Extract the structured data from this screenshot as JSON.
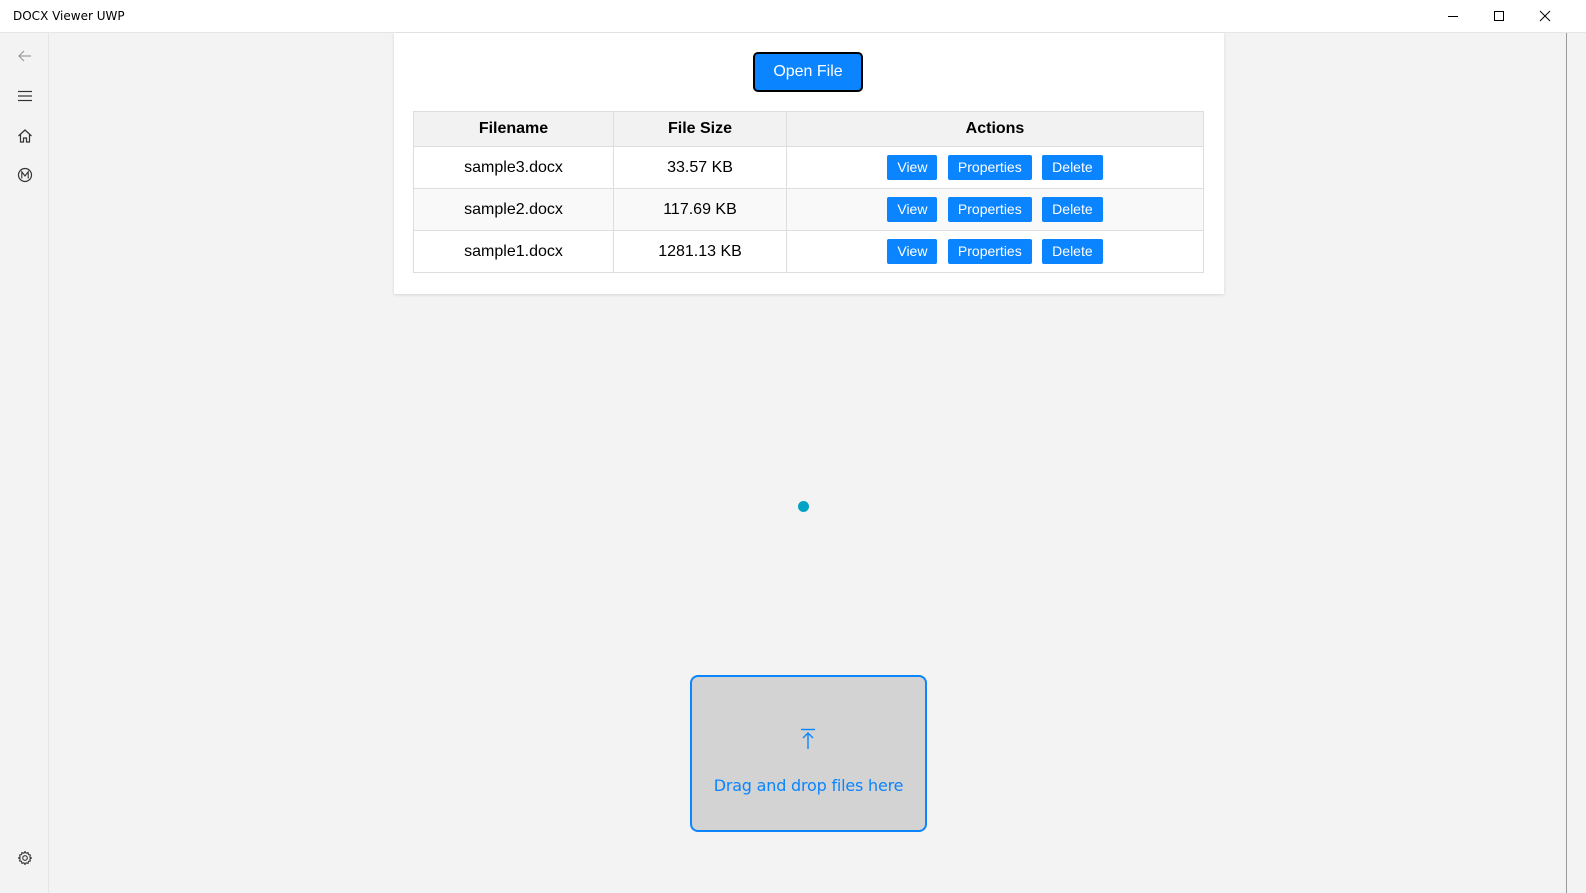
{
  "window": {
    "title": "DOCX Viewer UWP"
  },
  "nav": {
    "items": [
      {
        "icon": "back-arrow-icon"
      },
      {
        "icon": "hamburger-menu-icon"
      },
      {
        "icon": "home-icon"
      },
      {
        "icon": "m-circle-icon"
      },
      {
        "icon": "gear-icon"
      }
    ]
  },
  "toolbar": {
    "open_label": "Open File"
  },
  "table": {
    "headers": [
      "Filename",
      "File Size",
      "Actions"
    ],
    "rows": [
      {
        "name": "sample3.docx",
        "size": "33.57 KB"
      },
      {
        "name": "sample2.docx",
        "size": "117.69 KB"
      },
      {
        "name": "sample1.docx",
        "size": "1281.13 KB"
      }
    ],
    "actions": {
      "view": "View",
      "properties": "Properties",
      "delete": "Delete"
    }
  },
  "dropzone": {
    "text": "Drag and drop files here",
    "icon": "upload-arrow-icon"
  },
  "colors": {
    "accent": "#0a84ff",
    "progress": "#00a3c4",
    "background": "#f3f3f3"
  }
}
